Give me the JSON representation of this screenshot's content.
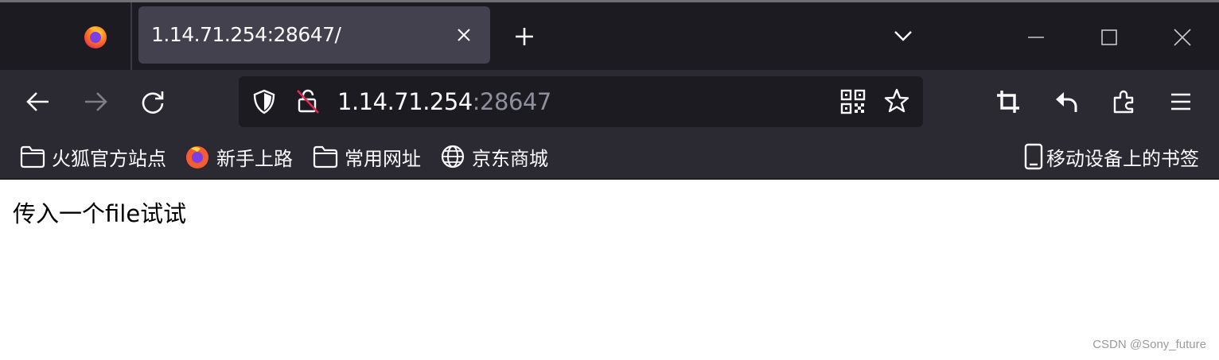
{
  "tab": {
    "title": "1.14.71.254:28647/"
  },
  "urlbar": {
    "host": "1.14.71.254",
    "port": ":28647"
  },
  "bookmarks": {
    "items": [
      {
        "label": "火狐官方站点",
        "icon": "folder-icon"
      },
      {
        "label": "新手上路",
        "icon": "firefox-icon"
      },
      {
        "label": "常用网址",
        "icon": "folder-icon"
      },
      {
        "label": "京东商城",
        "icon": "globe-icon"
      }
    ],
    "mobile": {
      "label": "移动设备上的书签",
      "icon": "mobile-icon"
    }
  },
  "page": {
    "text": "传入一个file试试"
  },
  "watermark": "CSDN @Sony_future"
}
